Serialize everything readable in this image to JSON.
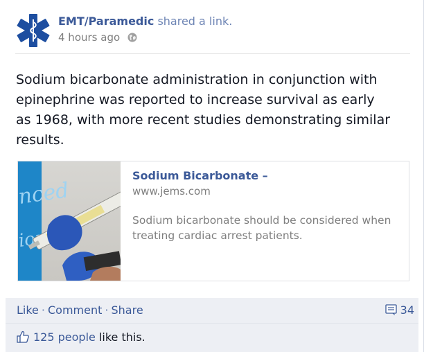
{
  "header": {
    "author": "EMT/Paramedic",
    "action": "shared a link.",
    "time": "4 hours ago",
    "globe_icon": "globe-icon",
    "avatar_icon": "star-of-life-icon"
  },
  "post": {
    "text": "Sodium bicarbonate administration in conjunction with epinephrine was reported to increase survival as early as 1968, with more recent studies demonstrating similar results."
  },
  "link_card": {
    "title": "Sodium Bicarbonate –",
    "domain": "www.jems.com",
    "description": "Sodium bicarbonate should be considered when treating cardiac arrest patients.",
    "thumbnail_icon": "syringe-photo-thumbnail"
  },
  "footer": {
    "like_label": "Like",
    "comment_label": "Comment",
    "share_label": "Share",
    "separator": "·",
    "comments_count": "34",
    "comments_icon": "comment-icon",
    "likes_link": "125 people",
    "likes_rest": " like this.",
    "like_icon": "thumbs-up-icon"
  },
  "colors": {
    "link_blue": "#3b5998",
    "muted_blue": "#6d84b4",
    "gray_text": "#7f7f7f",
    "footer_bg": "#edeff4"
  }
}
